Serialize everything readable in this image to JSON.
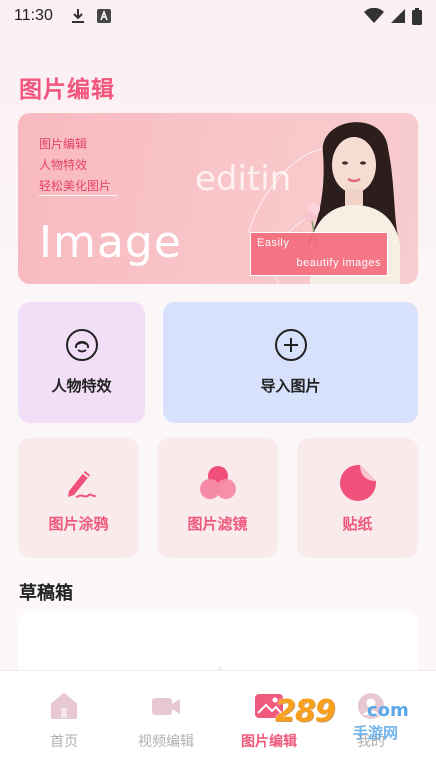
{
  "status_bar": {
    "time": "11:30",
    "icons": [
      "download-icon",
      "a-badge-icon",
      "wifi-icon",
      "signal-icon",
      "battery-icon"
    ]
  },
  "page": {
    "title": "图片编辑"
  },
  "banner": {
    "lines": [
      "图片编辑",
      "人物特效",
      "轻松美化图片"
    ],
    "big_text": "Image",
    "editing_text": "editin",
    "card_line1": "Easily",
    "card_line2": "beautify images"
  },
  "tiles": {
    "person_effects": {
      "label": "人物特效",
      "icon": "face-icon"
    },
    "import_image": {
      "label": "导入图片",
      "icon": "plus-circle-icon"
    }
  },
  "tools": [
    {
      "label": "图片涂鸦",
      "icon": "pen-icon"
    },
    {
      "label": "图片滤镜",
      "icon": "filter-circles-icon"
    },
    {
      "label": "贴纸",
      "icon": "sticker-icon"
    }
  ],
  "drafts": {
    "title": "草稿箱"
  },
  "bottom_nav": [
    {
      "label": "首页",
      "icon": "home-icon",
      "active": false
    },
    {
      "label": "视频编辑",
      "icon": "video-icon",
      "active": false
    },
    {
      "label": "图片编辑",
      "icon": "image-icon",
      "active": true
    },
    {
      "label": "我的",
      "icon": "profile-icon",
      "active": false
    }
  ],
  "watermark": {
    "number": "289",
    "domain": "com",
    "site": "手游网"
  },
  "colors": {
    "accent": "#ef5a7d",
    "title_pink": "#f2557d",
    "tile_purple": "#f3def7",
    "tile_blue": "#d7e1fb",
    "tile_pink": "#f9ebec"
  }
}
